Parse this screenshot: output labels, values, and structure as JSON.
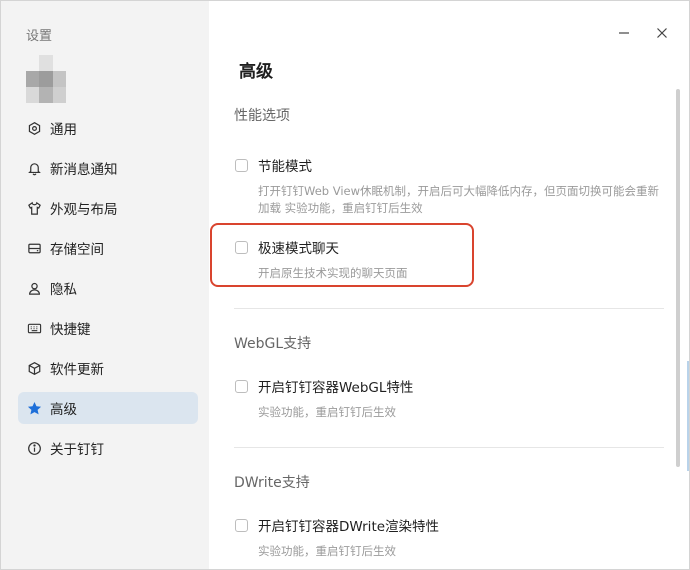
{
  "sidebar": {
    "title": "设置",
    "items": [
      {
        "label": "通用",
        "icon": "gear-icon"
      },
      {
        "label": "新消息通知",
        "icon": "bell-icon"
      },
      {
        "label": "外观与布局",
        "icon": "shirt-icon"
      },
      {
        "label": "存储空间",
        "icon": "storage-icon"
      },
      {
        "label": "隐私",
        "icon": "user-icon"
      },
      {
        "label": "快捷键",
        "icon": "keyboard-icon"
      },
      {
        "label": "软件更新",
        "icon": "box-icon"
      },
      {
        "label": "高级",
        "icon": "star-icon",
        "active": true
      },
      {
        "label": "关于钉钉",
        "icon": "info-icon"
      }
    ]
  },
  "main": {
    "title": "高级",
    "sections": [
      {
        "title": "性能选项",
        "options": [
          {
            "label": "节能模式",
            "desc": "打开钉钉Web View休眠机制，开启后可大幅降低内存，但页面切换可能会重新加载 实验功能，重启钉钉后生效",
            "checked": false
          },
          {
            "label": "极速模式聊天",
            "desc": "开启原生技术实现的聊天页面",
            "checked": false
          }
        ]
      },
      {
        "title": "WebGL支持",
        "options": [
          {
            "label": "开启钉钉容器WebGL特性",
            "desc": "实验功能，重启钉钉后生效",
            "checked": false
          }
        ]
      },
      {
        "title": "DWrite支持",
        "options": [
          {
            "label": "开启钉钉容器DWrite渲染特性",
            "desc": "实验功能，重启钉钉后生效",
            "checked": false
          }
        ]
      }
    ]
  },
  "colors": {
    "accent": "#1e6fd9",
    "active_bg": "#dbe5ef",
    "highlight": "#d9442e"
  }
}
